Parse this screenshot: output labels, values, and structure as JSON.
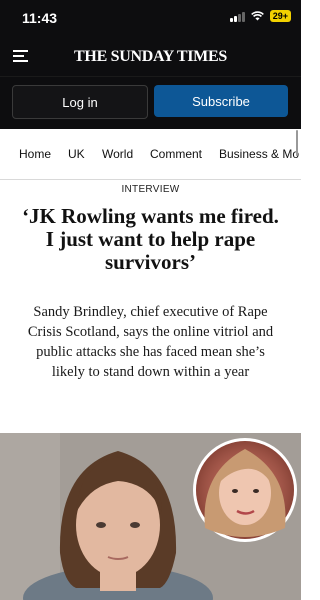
{
  "status": {
    "time": "11:43",
    "battery": "29+"
  },
  "masthead": {
    "logo": "THE SUNDAY TIMES"
  },
  "auth": {
    "login": "Log in",
    "subscribe": "Subscribe"
  },
  "nav": [
    "Home",
    "UK",
    "World",
    "Comment",
    "Business & Mo"
  ],
  "article": {
    "label": "INTERVIEW",
    "headline": "‘JK Rowling wants me fired. I just want to help rape survivors’",
    "standfirst": "Sandy Brindley, chief executive of Rape Crisis Scotland, says the online vitriol and public attacks she has faced mean she’s likely to stand down within a year"
  }
}
